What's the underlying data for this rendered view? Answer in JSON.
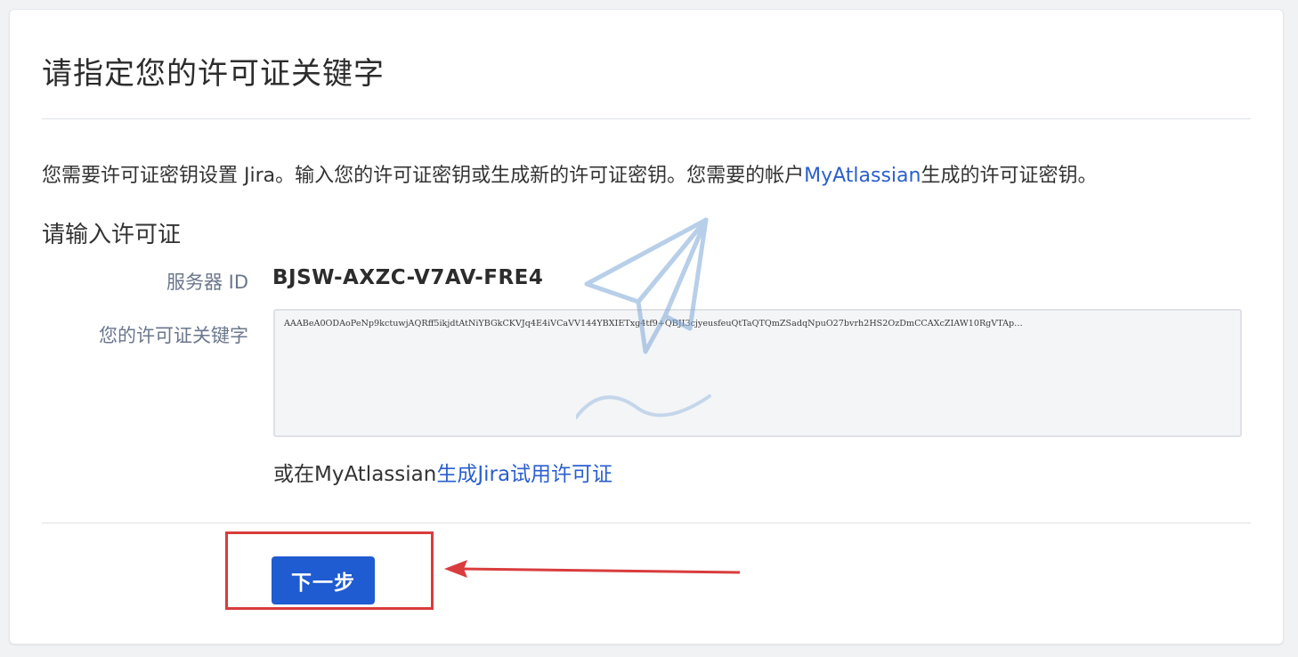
{
  "page": {
    "title": "请指定您的许可证关键字",
    "intro_before_link": "您需要许可证密钥设置 Jira。输入您的许可证密钥或生成新的许可证密钥。您需要的帐户",
    "intro_link": "MyAtlassian",
    "intro_after_link": "生成的许可证密钥。",
    "section_heading": "请输入许可证"
  },
  "form": {
    "server_id_label": "服务器 ID",
    "server_id_value": "BJSW-AXZC-V7AV-FRE4",
    "license_key_label": "您的许可证关键字",
    "license_key_value": "AAABeA0ODAoPeNp9kctuwjAQRff5ikjdtAtNiYBGkCKVJq4E4iVCaVV144YBXIETxg4tf9+QBJI3cjyeusfeuQtTaQTQmZSadqNpuO27bvrh2HS2OzDmCCAXcZIAW10RgVTAp…",
    "trial_prefix": "或在MyAtlassian",
    "trial_link": "生成Jira试用许可证"
  },
  "actions": {
    "next_label": "下一步"
  },
  "colors": {
    "link": "#2a5fce",
    "primary_button": "#1f5bd1",
    "annotation_red": "#d93c3c"
  },
  "icons": {
    "watermark": "paper-plane-icon"
  }
}
